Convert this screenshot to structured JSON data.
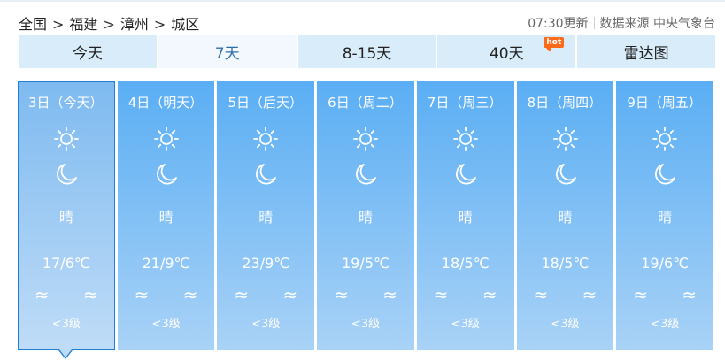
{
  "breadcrumb": {
    "items": [
      "全国",
      "福建",
      "漳州",
      "城区"
    ],
    "separator": ">"
  },
  "meta": {
    "update_time": "07:30更新",
    "source": "数据来源 中央气象台"
  },
  "tabs": [
    {
      "label": "今天",
      "active": false
    },
    {
      "label": "7天",
      "active": true
    },
    {
      "label": "8-15天",
      "active": false
    },
    {
      "label": "40天",
      "active": false,
      "badge": "hot"
    },
    {
      "label": "雷达图",
      "active": false
    }
  ],
  "days": [
    {
      "date": "3日（今天）",
      "weather": "晴",
      "temp": "17/6℃",
      "wind_icons": "≈ ≈",
      "wind_level": "<3级",
      "active": true
    },
    {
      "date": "4日（明天）",
      "weather": "晴",
      "temp": "21/9℃",
      "wind_icons": "≈ ≈",
      "wind_level": "<3级",
      "active": false
    },
    {
      "date": "5日（后天）",
      "weather": "晴",
      "temp": "23/9℃",
      "wind_icons": "≈ ≈",
      "wind_level": "<3级",
      "active": false
    },
    {
      "date": "6日（周二）",
      "weather": "晴",
      "temp": "19/5℃",
      "wind_icons": "≈ ≈",
      "wind_level": "<3级",
      "active": false
    },
    {
      "date": "7日（周三）",
      "weather": "晴",
      "temp": "18/5℃",
      "wind_icons": "≈ ≈",
      "wind_level": "<3级",
      "active": false
    },
    {
      "date": "8日（周四）",
      "weather": "晴",
      "temp": "18/5℃",
      "wind_icons": "≈ ≈",
      "wind_level": "<3级",
      "active": false
    },
    {
      "date": "9日（周五）",
      "weather": "晴",
      "temp": "19/6℃",
      "wind_icons": "≈ ≈",
      "wind_level": "<3级",
      "active": false
    }
  ],
  "icons": {
    "day": "sun-icon",
    "night": "moon-icon"
  },
  "colors": {
    "tab_bg": "#d8ecfa",
    "active_tab_text": "#2e6fae",
    "card_top": "#5aaef4",
    "card_bottom": "#a9d2f6",
    "hot_badge": "#ff6a1a"
  }
}
